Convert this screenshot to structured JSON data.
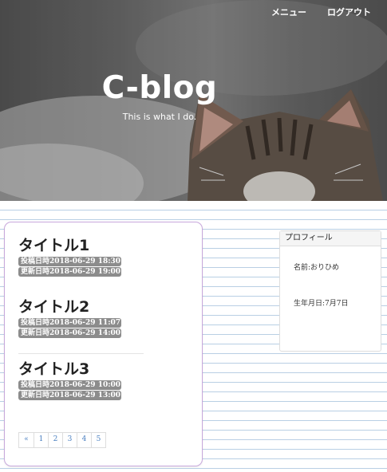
{
  "nav": {
    "menu_label": "メニュー",
    "logout_label": "ログアウト"
  },
  "hero": {
    "title": "C-blog",
    "subtitle": "This is what I do."
  },
  "posts": [
    {
      "title": "タイトル1",
      "posted": "投稿日時2018-06-29 18:30",
      "updated": "更新日時2018-06-29 19:00"
    },
    {
      "title": "タイトル2",
      "posted": "投稿日時2018-06-29 11:07",
      "updated": "更新日時2018-06-29 14:00"
    },
    {
      "title": "タイトル3",
      "posted": "投稿日時2018-06-29 10:00",
      "updated": "更新日時2018-06-29 13:00"
    }
  ],
  "pagination": {
    "prev": "«",
    "pages": [
      "1",
      "2",
      "3",
      "4",
      "5"
    ]
  },
  "profile": {
    "heading": "プロフィール",
    "name": "名前:おりひめ",
    "birthday": "生年月日:7月7日"
  },
  "colors": {
    "badge": "#8c8c8c",
    "card_border": "#c8a8dc",
    "page_link": "#4a7fc0",
    "ruled_lines": "#b9cfe4"
  }
}
